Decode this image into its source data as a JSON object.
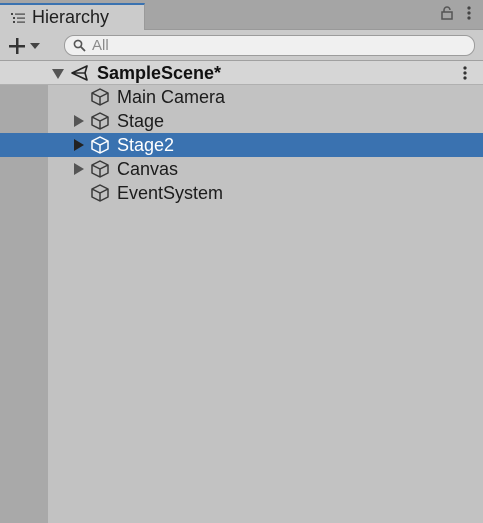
{
  "window": {
    "tab_title": "Hierarchy",
    "tab_icon": "hierarchy-list-icon",
    "lock_icon": "lock-icon",
    "menu_icon": "kebab-menu-icon"
  },
  "toolbar": {
    "create_icon": "plus-icon",
    "create_dropdown_icon": "chevron-down-icon",
    "search_placeholder": "All",
    "search_icon": "search-icon"
  },
  "scene": {
    "name": "SampleScene*",
    "icon": "unity-scene-icon",
    "expanded": true
  },
  "items": [
    {
      "label": "Main Camera",
      "has_children": false,
      "selected": false
    },
    {
      "label": "Stage",
      "has_children": true,
      "selected": false
    },
    {
      "label": "Stage2",
      "has_children": true,
      "selected": true
    },
    {
      "label": "Canvas",
      "has_children": true,
      "selected": false
    },
    {
      "label": "EventSystem",
      "has_children": false,
      "selected": false
    }
  ],
  "colors": {
    "selection": "#3a72b0",
    "panel_bg": "#c2c2c2",
    "tab_accent": "#3a72b0"
  }
}
